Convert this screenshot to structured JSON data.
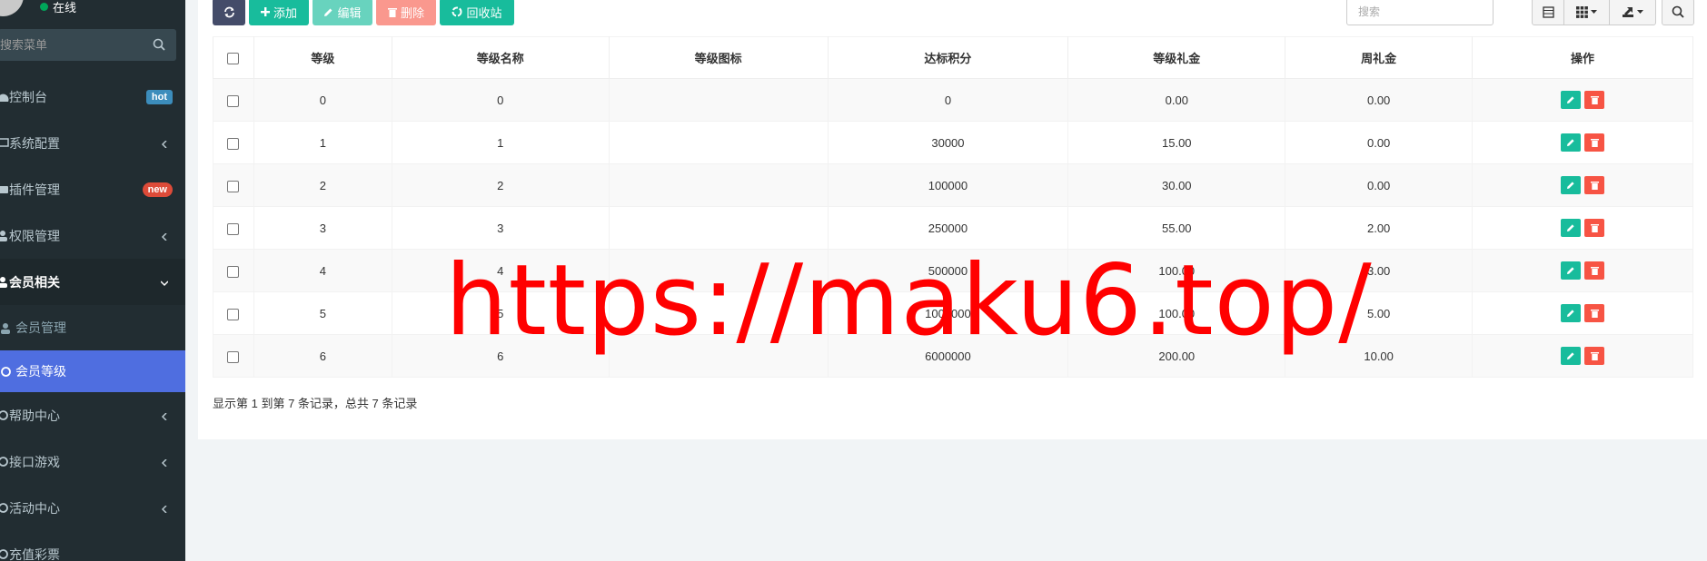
{
  "sidebar": {
    "user_status": "在线",
    "search_placeholder": "搜索菜单",
    "items": [
      {
        "label": "控制台",
        "badge": "hot"
      },
      {
        "label": "系统配置"
      },
      {
        "label": "插件管理",
        "badge": "new"
      },
      {
        "label": "权限管理"
      },
      {
        "label": "会员相关"
      },
      {
        "label": "会员管理"
      },
      {
        "label": "会员等级"
      },
      {
        "label": "帮助中心"
      },
      {
        "label": "接口游戏"
      },
      {
        "label": "活动中心"
      },
      {
        "label": "充值彩票"
      }
    ]
  },
  "toolbar": {
    "add_label": "添加",
    "edit_label": "编辑",
    "delete_label": "删除",
    "recycle_label": "回收站",
    "search_placeholder": "搜索"
  },
  "table": {
    "headers": [
      "等级",
      "等级名称",
      "等级图标",
      "达标积分",
      "等级礼金",
      "周礼金",
      "操作"
    ],
    "rows": [
      {
        "level": "0",
        "name": "0",
        "icon": "",
        "points": "0",
        "gift": "0.00",
        "weekly": "0.00"
      },
      {
        "level": "1",
        "name": "1",
        "icon": "",
        "points": "30000",
        "gift": "15.00",
        "weekly": "0.00"
      },
      {
        "level": "2",
        "name": "2",
        "icon": "",
        "points": "100000",
        "gift": "30.00",
        "weekly": "0.00"
      },
      {
        "level": "3",
        "name": "3",
        "icon": "",
        "points": "250000",
        "gift": "55.00",
        "weekly": "2.00"
      },
      {
        "level": "4",
        "name": "4",
        "icon": "",
        "points": "500000",
        "gift": "100.00",
        "weekly": "3.00"
      },
      {
        "level": "5",
        "name": "5",
        "icon": "",
        "points": "1000000",
        "gift": "100.00",
        "weekly": "5.00"
      },
      {
        "level": "6",
        "name": "6",
        "icon": "",
        "points": "6000000",
        "gift": "200.00",
        "weekly": "10.00"
      }
    ]
  },
  "pagination_info": "显示第 1 到第 7 条记录，总共 7 条记录",
  "watermark": "https://maku6.top/",
  "colors": {
    "sidebar_bg": "#222d32",
    "active_menu": "#4f6ee0",
    "primary_green": "#18bc9c",
    "danger_red": "#f75444",
    "watermark": "#ff0000"
  }
}
